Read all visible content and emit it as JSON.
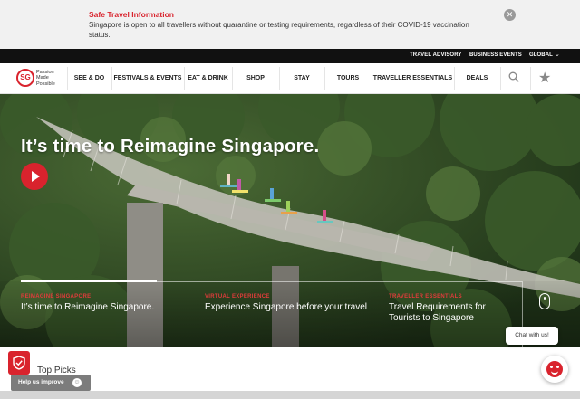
{
  "alert": {
    "title": "Safe Travel Information",
    "message": "Singapore is open to all travellers without quarantine or testing requirements, regardless of their COVID-19 vaccination status.",
    "close_icon": "close-icon"
  },
  "utility_bar": {
    "links": [
      "TRAVEL ADVISORY",
      "BUSINESS EVENTS",
      "GLOBAL"
    ]
  },
  "brand": {
    "logo_mark": "SG",
    "tagline": "Passion Made Possible",
    "tagline_lines": [
      "Passion",
      "Made",
      "Possible"
    ],
    "accent_color": "#d9232d"
  },
  "nav": {
    "items": [
      "SEE & DO",
      "FESTIVALS & EVENTS",
      "EAT & DRINK",
      "SHOP",
      "STAY",
      "TOURS",
      "TRAVELLER ESSENTIALS",
      "DEALS"
    ],
    "search_icon": "search-icon",
    "favourites_icon": "star-icon"
  },
  "hero": {
    "title": "It’s time to Reimagine Singapore.",
    "play_icon": "play-icon",
    "cards": [
      {
        "kicker": "REIMAGINE SINGAPORE",
        "title": "It’s time to Reimagine Singapore."
      },
      {
        "kicker": "VIRTUAL EXPERIENCE",
        "title": "Experience Singapore before your travel"
      },
      {
        "kicker": "TRAVELLER ESSENTIALS",
        "title": "Travel Requirements for Tourists to Singapore"
      }
    ],
    "scroll_icon": "mouse-scroll-icon"
  },
  "chat": {
    "label": "Chat with us!",
    "avatar_icon": "chatbot-avatar-icon"
  },
  "sections": {
    "top_picks": "Top Picks"
  },
  "feedback": {
    "label": "Help us improve",
    "shield_icon": "shield-check-icon",
    "smile_icon": "smile-icon"
  }
}
